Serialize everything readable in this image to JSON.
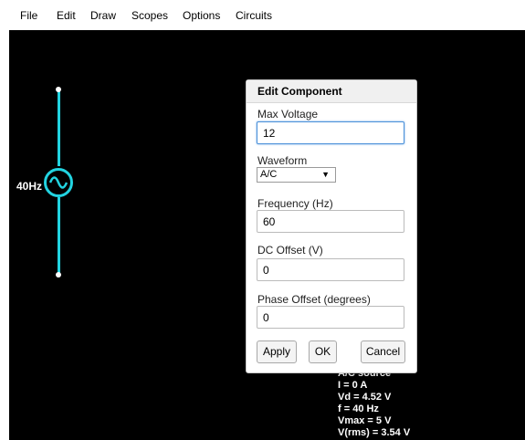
{
  "menu": {
    "items": [
      {
        "label": "File"
      },
      {
        "label": "Edit"
      },
      {
        "label": "Draw"
      },
      {
        "label": "Scopes"
      },
      {
        "label": "Options"
      },
      {
        "label": "Circuits"
      }
    ]
  },
  "circuit": {
    "source_label": "40Hz",
    "wire_color": "#22d3e0"
  },
  "dialog": {
    "title": "Edit Component",
    "max_voltage": {
      "label": "Max Voltage",
      "value": "12"
    },
    "waveform": {
      "label": "Waveform",
      "selected": "A/C"
    },
    "frequency": {
      "label": "Frequency (Hz)",
      "value": "60"
    },
    "dc_offset": {
      "label": "DC Offset (V)",
      "value": "0"
    },
    "phase_offset": {
      "label": "Phase Offset (degrees)",
      "value": "0"
    },
    "buttons": {
      "apply": "Apply",
      "ok": "OK",
      "cancel": "Cancel"
    }
  },
  "info": {
    "lines": [
      "A/C source",
      "I = 0 A",
      "Vd = 4.52 V",
      "f = 40 Hz",
      "Vmax = 5 V",
      "V(rms) = 3.54 V"
    ]
  }
}
